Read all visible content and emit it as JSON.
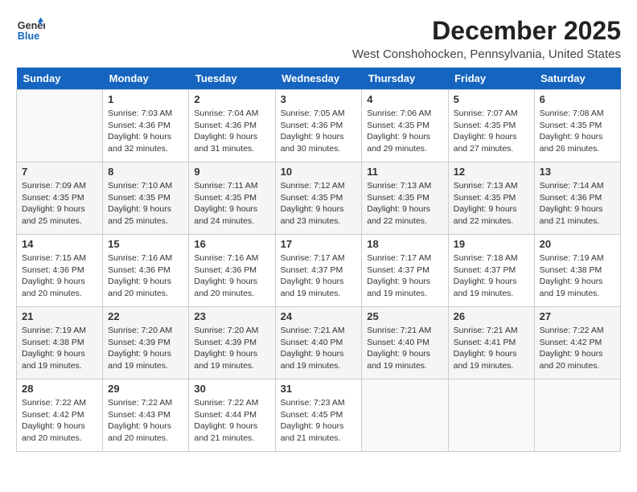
{
  "logo": {
    "line1": "General",
    "line2": "Blue"
  },
  "title": "December 2025",
  "location": "West Conshohocken, Pennsylvania, United States",
  "weekdays": [
    "Sunday",
    "Monday",
    "Tuesday",
    "Wednesday",
    "Thursday",
    "Friday",
    "Saturday"
  ],
  "weeks": [
    [
      {
        "day": "",
        "sunrise": "",
        "sunset": "",
        "daylight": ""
      },
      {
        "day": "1",
        "sunrise": "Sunrise: 7:03 AM",
        "sunset": "Sunset: 4:36 PM",
        "daylight": "Daylight: 9 hours and 32 minutes."
      },
      {
        "day": "2",
        "sunrise": "Sunrise: 7:04 AM",
        "sunset": "Sunset: 4:36 PM",
        "daylight": "Daylight: 9 hours and 31 minutes."
      },
      {
        "day": "3",
        "sunrise": "Sunrise: 7:05 AM",
        "sunset": "Sunset: 4:36 PM",
        "daylight": "Daylight: 9 hours and 30 minutes."
      },
      {
        "day": "4",
        "sunrise": "Sunrise: 7:06 AM",
        "sunset": "Sunset: 4:35 PM",
        "daylight": "Daylight: 9 hours and 29 minutes."
      },
      {
        "day": "5",
        "sunrise": "Sunrise: 7:07 AM",
        "sunset": "Sunset: 4:35 PM",
        "daylight": "Daylight: 9 hours and 27 minutes."
      },
      {
        "day": "6",
        "sunrise": "Sunrise: 7:08 AM",
        "sunset": "Sunset: 4:35 PM",
        "daylight": "Daylight: 9 hours and 26 minutes."
      }
    ],
    [
      {
        "day": "7",
        "sunrise": "Sunrise: 7:09 AM",
        "sunset": "Sunset: 4:35 PM",
        "daylight": "Daylight: 9 hours and 25 minutes."
      },
      {
        "day": "8",
        "sunrise": "Sunrise: 7:10 AM",
        "sunset": "Sunset: 4:35 PM",
        "daylight": "Daylight: 9 hours and 25 minutes."
      },
      {
        "day": "9",
        "sunrise": "Sunrise: 7:11 AM",
        "sunset": "Sunset: 4:35 PM",
        "daylight": "Daylight: 9 hours and 24 minutes."
      },
      {
        "day": "10",
        "sunrise": "Sunrise: 7:12 AM",
        "sunset": "Sunset: 4:35 PM",
        "daylight": "Daylight: 9 hours and 23 minutes."
      },
      {
        "day": "11",
        "sunrise": "Sunrise: 7:13 AM",
        "sunset": "Sunset: 4:35 PM",
        "daylight": "Daylight: 9 hours and 22 minutes."
      },
      {
        "day": "12",
        "sunrise": "Sunrise: 7:13 AM",
        "sunset": "Sunset: 4:35 PM",
        "daylight": "Daylight: 9 hours and 22 minutes."
      },
      {
        "day": "13",
        "sunrise": "Sunrise: 7:14 AM",
        "sunset": "Sunset: 4:36 PM",
        "daylight": "Daylight: 9 hours and 21 minutes."
      }
    ],
    [
      {
        "day": "14",
        "sunrise": "Sunrise: 7:15 AM",
        "sunset": "Sunset: 4:36 PM",
        "daylight": "Daylight: 9 hours and 20 minutes."
      },
      {
        "day": "15",
        "sunrise": "Sunrise: 7:16 AM",
        "sunset": "Sunset: 4:36 PM",
        "daylight": "Daylight: 9 hours and 20 minutes."
      },
      {
        "day": "16",
        "sunrise": "Sunrise: 7:16 AM",
        "sunset": "Sunset: 4:36 PM",
        "daylight": "Daylight: 9 hours and 20 minutes."
      },
      {
        "day": "17",
        "sunrise": "Sunrise: 7:17 AM",
        "sunset": "Sunset: 4:37 PM",
        "daylight": "Daylight: 9 hours and 19 minutes."
      },
      {
        "day": "18",
        "sunrise": "Sunrise: 7:17 AM",
        "sunset": "Sunset: 4:37 PM",
        "daylight": "Daylight: 9 hours and 19 minutes."
      },
      {
        "day": "19",
        "sunrise": "Sunrise: 7:18 AM",
        "sunset": "Sunset: 4:37 PM",
        "daylight": "Daylight: 9 hours and 19 minutes."
      },
      {
        "day": "20",
        "sunrise": "Sunrise: 7:19 AM",
        "sunset": "Sunset: 4:38 PM",
        "daylight": "Daylight: 9 hours and 19 minutes."
      }
    ],
    [
      {
        "day": "21",
        "sunrise": "Sunrise: 7:19 AM",
        "sunset": "Sunset: 4:38 PM",
        "daylight": "Daylight: 9 hours and 19 minutes."
      },
      {
        "day": "22",
        "sunrise": "Sunrise: 7:20 AM",
        "sunset": "Sunset: 4:39 PM",
        "daylight": "Daylight: 9 hours and 19 minutes."
      },
      {
        "day": "23",
        "sunrise": "Sunrise: 7:20 AM",
        "sunset": "Sunset: 4:39 PM",
        "daylight": "Daylight: 9 hours and 19 minutes."
      },
      {
        "day": "24",
        "sunrise": "Sunrise: 7:21 AM",
        "sunset": "Sunset: 4:40 PM",
        "daylight": "Daylight: 9 hours and 19 minutes."
      },
      {
        "day": "25",
        "sunrise": "Sunrise: 7:21 AM",
        "sunset": "Sunset: 4:40 PM",
        "daylight": "Daylight: 9 hours and 19 minutes."
      },
      {
        "day": "26",
        "sunrise": "Sunrise: 7:21 AM",
        "sunset": "Sunset: 4:41 PM",
        "daylight": "Daylight: 9 hours and 19 minutes."
      },
      {
        "day": "27",
        "sunrise": "Sunrise: 7:22 AM",
        "sunset": "Sunset: 4:42 PM",
        "daylight": "Daylight: 9 hours and 20 minutes."
      }
    ],
    [
      {
        "day": "28",
        "sunrise": "Sunrise: 7:22 AM",
        "sunset": "Sunset: 4:42 PM",
        "daylight": "Daylight: 9 hours and 20 minutes."
      },
      {
        "day": "29",
        "sunrise": "Sunrise: 7:22 AM",
        "sunset": "Sunset: 4:43 PM",
        "daylight": "Daylight: 9 hours and 20 minutes."
      },
      {
        "day": "30",
        "sunrise": "Sunrise: 7:22 AM",
        "sunset": "Sunset: 4:44 PM",
        "daylight": "Daylight: 9 hours and 21 minutes."
      },
      {
        "day": "31",
        "sunrise": "Sunrise: 7:23 AM",
        "sunset": "Sunset: 4:45 PM",
        "daylight": "Daylight: 9 hours and 21 minutes."
      },
      {
        "day": "",
        "sunrise": "",
        "sunset": "",
        "daylight": ""
      },
      {
        "day": "",
        "sunrise": "",
        "sunset": "",
        "daylight": ""
      },
      {
        "day": "",
        "sunrise": "",
        "sunset": "",
        "daylight": ""
      }
    ]
  ]
}
